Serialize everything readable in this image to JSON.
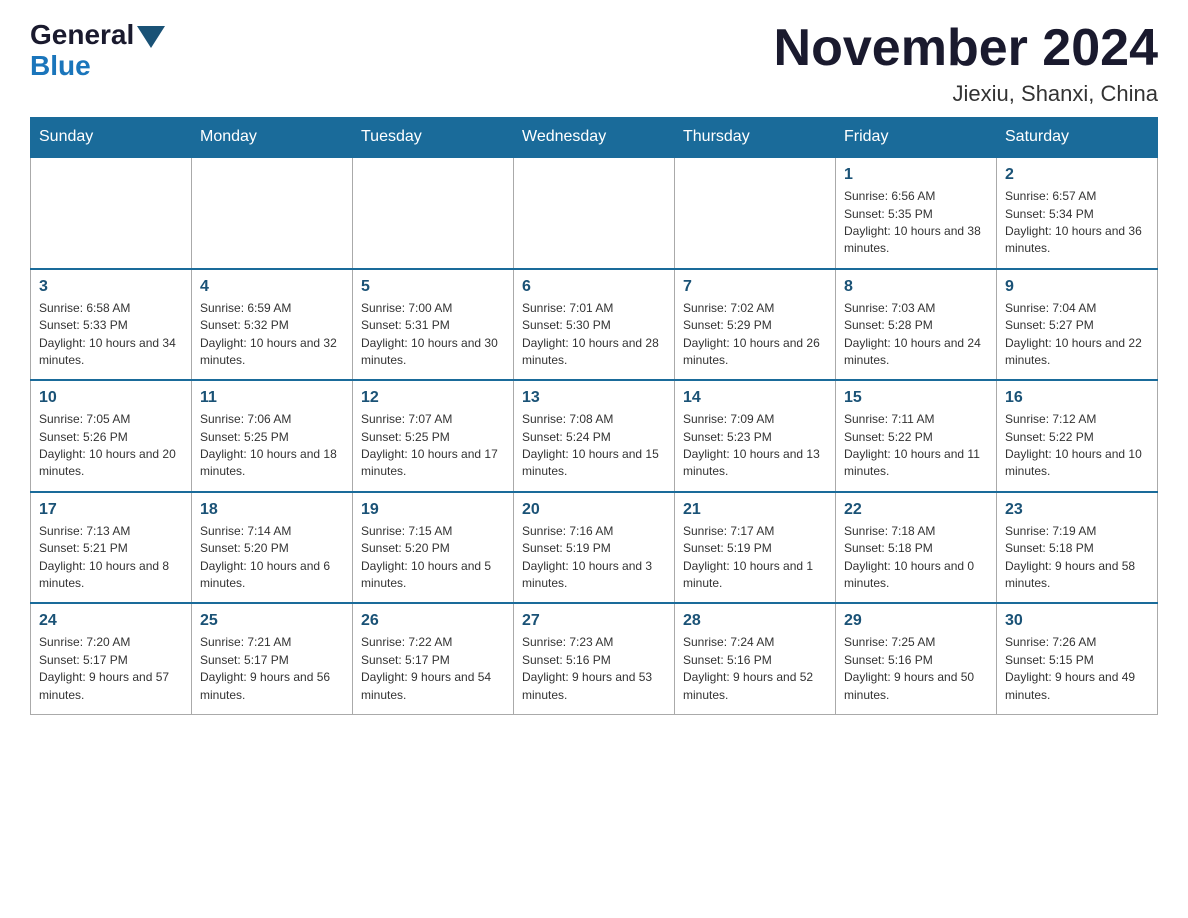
{
  "header": {
    "title": "November 2024",
    "location": "Jiexiu, Shanxi, China",
    "logo_general": "General",
    "logo_blue": "Blue"
  },
  "days_of_week": [
    "Sunday",
    "Monday",
    "Tuesday",
    "Wednesday",
    "Thursday",
    "Friday",
    "Saturday"
  ],
  "weeks": [
    [
      {
        "day": "",
        "info": ""
      },
      {
        "day": "",
        "info": ""
      },
      {
        "day": "",
        "info": ""
      },
      {
        "day": "",
        "info": ""
      },
      {
        "day": "",
        "info": ""
      },
      {
        "day": "1",
        "info": "Sunrise: 6:56 AM\nSunset: 5:35 PM\nDaylight: 10 hours and 38 minutes."
      },
      {
        "day": "2",
        "info": "Sunrise: 6:57 AM\nSunset: 5:34 PM\nDaylight: 10 hours and 36 minutes."
      }
    ],
    [
      {
        "day": "3",
        "info": "Sunrise: 6:58 AM\nSunset: 5:33 PM\nDaylight: 10 hours and 34 minutes."
      },
      {
        "day": "4",
        "info": "Sunrise: 6:59 AM\nSunset: 5:32 PM\nDaylight: 10 hours and 32 minutes."
      },
      {
        "day": "5",
        "info": "Sunrise: 7:00 AM\nSunset: 5:31 PM\nDaylight: 10 hours and 30 minutes."
      },
      {
        "day": "6",
        "info": "Sunrise: 7:01 AM\nSunset: 5:30 PM\nDaylight: 10 hours and 28 minutes."
      },
      {
        "day": "7",
        "info": "Sunrise: 7:02 AM\nSunset: 5:29 PM\nDaylight: 10 hours and 26 minutes."
      },
      {
        "day": "8",
        "info": "Sunrise: 7:03 AM\nSunset: 5:28 PM\nDaylight: 10 hours and 24 minutes."
      },
      {
        "day": "9",
        "info": "Sunrise: 7:04 AM\nSunset: 5:27 PM\nDaylight: 10 hours and 22 minutes."
      }
    ],
    [
      {
        "day": "10",
        "info": "Sunrise: 7:05 AM\nSunset: 5:26 PM\nDaylight: 10 hours and 20 minutes."
      },
      {
        "day": "11",
        "info": "Sunrise: 7:06 AM\nSunset: 5:25 PM\nDaylight: 10 hours and 18 minutes."
      },
      {
        "day": "12",
        "info": "Sunrise: 7:07 AM\nSunset: 5:25 PM\nDaylight: 10 hours and 17 minutes."
      },
      {
        "day": "13",
        "info": "Sunrise: 7:08 AM\nSunset: 5:24 PM\nDaylight: 10 hours and 15 minutes."
      },
      {
        "day": "14",
        "info": "Sunrise: 7:09 AM\nSunset: 5:23 PM\nDaylight: 10 hours and 13 minutes."
      },
      {
        "day": "15",
        "info": "Sunrise: 7:11 AM\nSunset: 5:22 PM\nDaylight: 10 hours and 11 minutes."
      },
      {
        "day": "16",
        "info": "Sunrise: 7:12 AM\nSunset: 5:22 PM\nDaylight: 10 hours and 10 minutes."
      }
    ],
    [
      {
        "day": "17",
        "info": "Sunrise: 7:13 AM\nSunset: 5:21 PM\nDaylight: 10 hours and 8 minutes."
      },
      {
        "day": "18",
        "info": "Sunrise: 7:14 AM\nSunset: 5:20 PM\nDaylight: 10 hours and 6 minutes."
      },
      {
        "day": "19",
        "info": "Sunrise: 7:15 AM\nSunset: 5:20 PM\nDaylight: 10 hours and 5 minutes."
      },
      {
        "day": "20",
        "info": "Sunrise: 7:16 AM\nSunset: 5:19 PM\nDaylight: 10 hours and 3 minutes."
      },
      {
        "day": "21",
        "info": "Sunrise: 7:17 AM\nSunset: 5:19 PM\nDaylight: 10 hours and 1 minute."
      },
      {
        "day": "22",
        "info": "Sunrise: 7:18 AM\nSunset: 5:18 PM\nDaylight: 10 hours and 0 minutes."
      },
      {
        "day": "23",
        "info": "Sunrise: 7:19 AM\nSunset: 5:18 PM\nDaylight: 9 hours and 58 minutes."
      }
    ],
    [
      {
        "day": "24",
        "info": "Sunrise: 7:20 AM\nSunset: 5:17 PM\nDaylight: 9 hours and 57 minutes."
      },
      {
        "day": "25",
        "info": "Sunrise: 7:21 AM\nSunset: 5:17 PM\nDaylight: 9 hours and 56 minutes."
      },
      {
        "day": "26",
        "info": "Sunrise: 7:22 AM\nSunset: 5:17 PM\nDaylight: 9 hours and 54 minutes."
      },
      {
        "day": "27",
        "info": "Sunrise: 7:23 AM\nSunset: 5:16 PM\nDaylight: 9 hours and 53 minutes."
      },
      {
        "day": "28",
        "info": "Sunrise: 7:24 AM\nSunset: 5:16 PM\nDaylight: 9 hours and 52 minutes."
      },
      {
        "day": "29",
        "info": "Sunrise: 7:25 AM\nSunset: 5:16 PM\nDaylight: 9 hours and 50 minutes."
      },
      {
        "day": "30",
        "info": "Sunrise: 7:26 AM\nSunset: 5:15 PM\nDaylight: 9 hours and 49 minutes."
      }
    ]
  ]
}
